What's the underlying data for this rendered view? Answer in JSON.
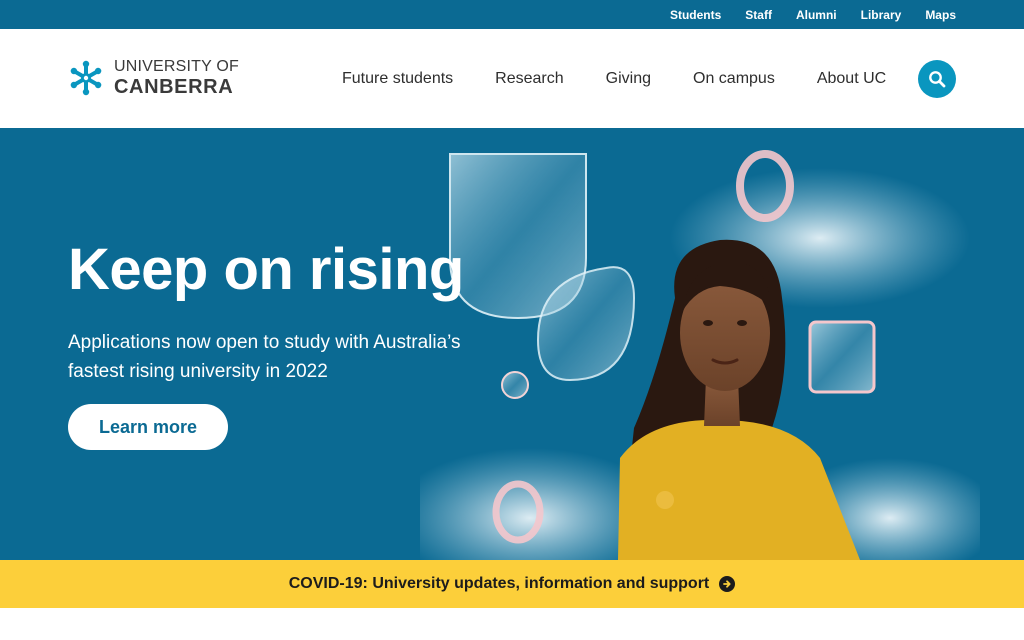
{
  "utility_nav": {
    "links": [
      "Students",
      "Staff",
      "Alumni",
      "Library",
      "Maps"
    ]
  },
  "logo": {
    "line1": "UNIVERSITY OF",
    "line2": "CANBERRA",
    "icon": "uc-snowflake-logo-icon"
  },
  "main_nav": {
    "items": [
      "Future students",
      "Research",
      "Giving",
      "On campus",
      "About UC"
    ]
  },
  "search": {
    "icon": "search-icon"
  },
  "hero": {
    "title": "Keep on rising",
    "subtitle": "Applications now open to study with Australia’s fastest rising university in 2022",
    "cta_label": "Learn more"
  },
  "covid_banner": {
    "text": "COVID-19: University updates, information and support",
    "icon": "arrow-right-circle-icon"
  },
  "colors": {
    "brand_blue": "#0b6a93",
    "accent_cyan": "#0a96bf",
    "banner_yellow": "#fccf3a"
  }
}
